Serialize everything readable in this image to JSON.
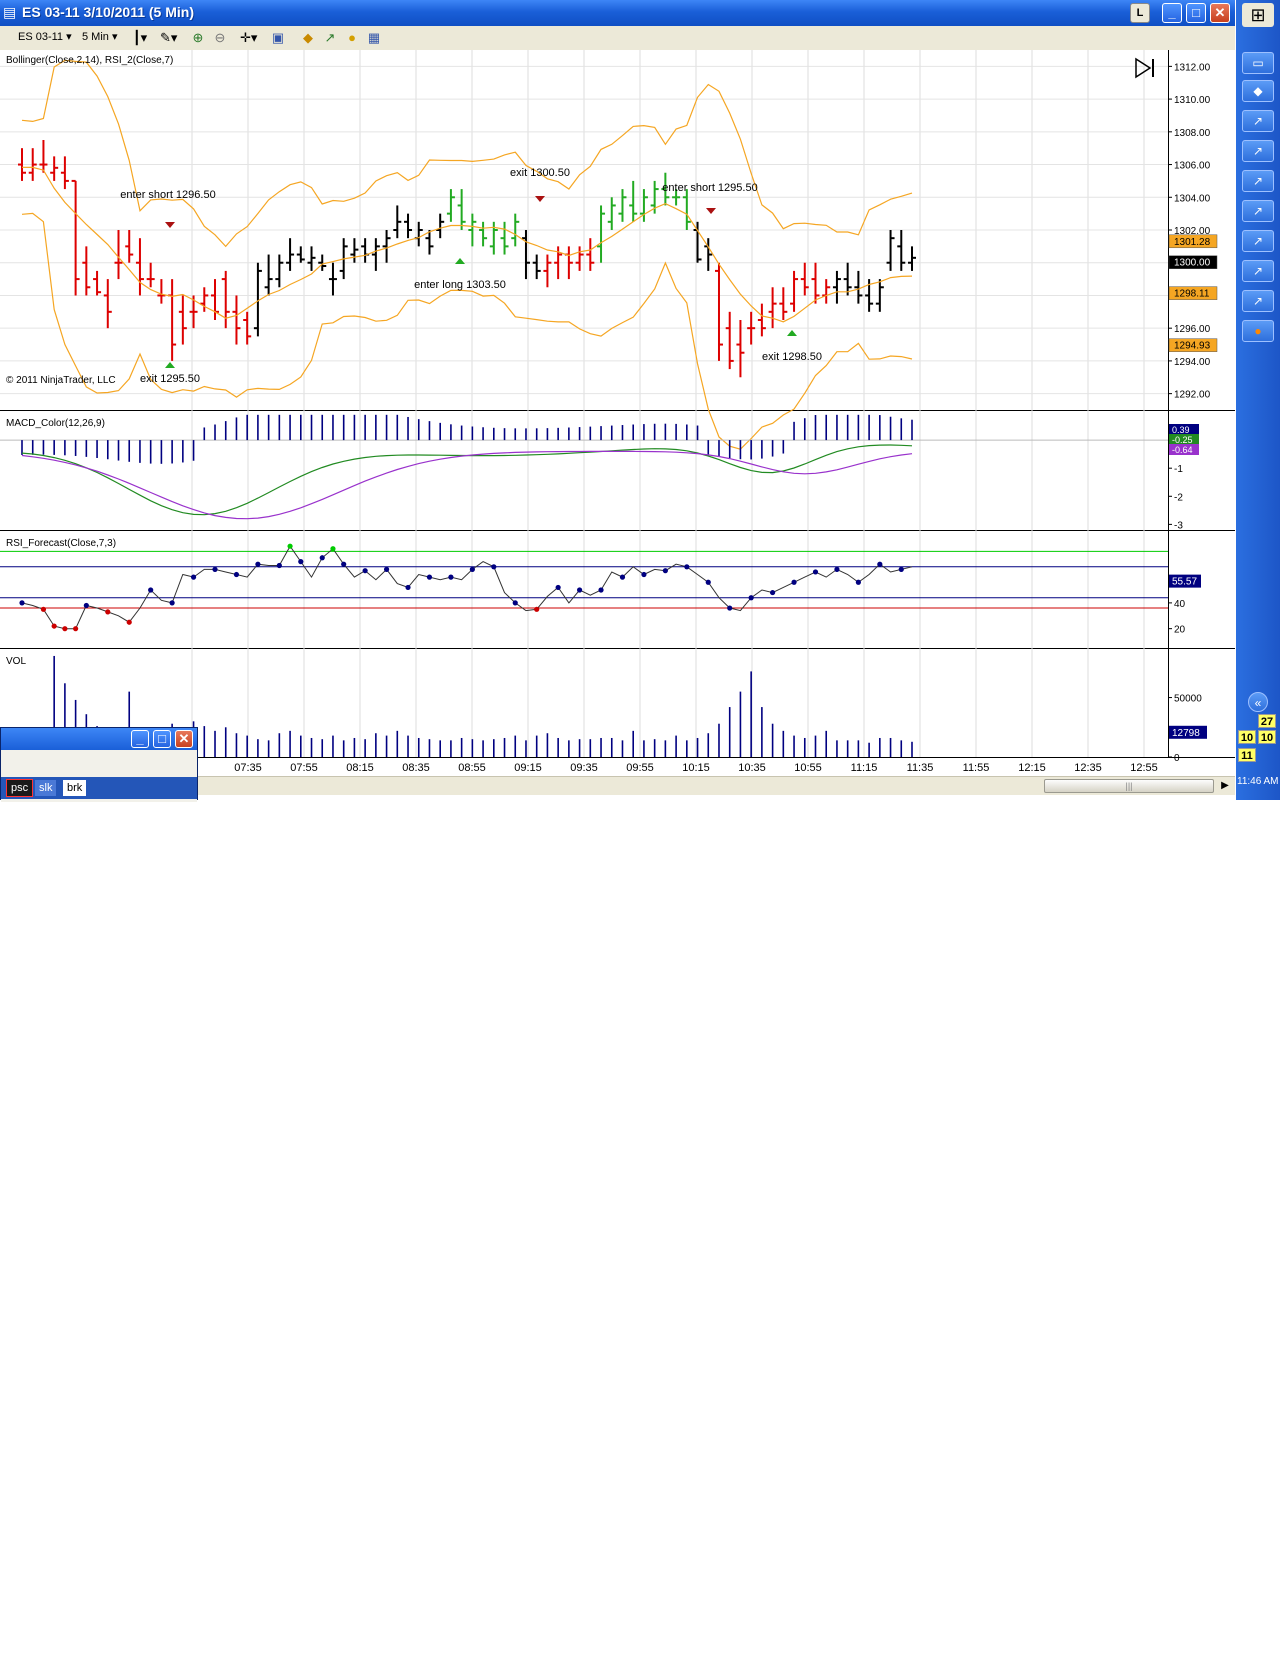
{
  "window": {
    "title": "ES 03-11  3/10/2011 (5 Min)",
    "btn_l": "L",
    "btn_min": "_",
    "btn_max": "□",
    "btn_close": "✕"
  },
  "toolbar": {
    "instrument": "ES 03-11",
    "interval": "5 Min",
    "icons": [
      "bar-type-icon",
      "pencil-icon",
      "zoom-in-icon",
      "zoom-out-icon",
      "crosshair-icon",
      "properties-icon",
      "strategy-icon",
      "indicators-icon",
      "dollar-icon",
      "data-box-icon"
    ]
  },
  "chart": {
    "price_panel_label": "Bollinger(Close,2,14), RSI_2(Close,7)",
    "macd_panel_label": "MACD_Color(12,26,9)",
    "rsi_panel_label": "RSI_Forecast(Close,7,3)",
    "vol_panel_label": "VOL",
    "copyright": "© 2011 NinjaTrader, LLC",
    "price_ticks": [
      "1312.00",
      "1310.00",
      "1308.00",
      "1306.00",
      "1304.00",
      "1302.00",
      "1300.00",
      "1298.00",
      "1296.00",
      "1294.00",
      "1292.00"
    ],
    "price_tick_values": [
      1312,
      1310,
      1308,
      1306,
      1304,
      1302,
      1300,
      1298,
      1296,
      1294,
      1292
    ],
    "macd_ticks": [
      "-1",
      "-2",
      "-3"
    ],
    "rsi_ticks": [
      "40",
      "20"
    ],
    "vol_ticks": [
      "50000",
      "0"
    ],
    "time_ticks": [
      "5",
      "07:35",
      "07:55",
      "08:15",
      "08:35",
      "08:55",
      "09:15",
      "09:35",
      "09:55",
      "10:15",
      "10:35",
      "10:55",
      "11:15",
      "11:35",
      "11:55",
      "12:15",
      "12:35",
      "12:55"
    ],
    "price_badges": [
      {
        "label": "1301.28",
        "value": 1301.28,
        "bg": "#f5a623",
        "fg": "#000000"
      },
      {
        "label": "1300.00",
        "value": 1300.0,
        "bg": "#000000",
        "fg": "#ffffff"
      },
      {
        "label": "1298.11",
        "value": 1298.11,
        "bg": "#f5a623",
        "fg": "#000000"
      },
      {
        "label": "1294.93",
        "value": 1294.93,
        "bg": "#f5a623",
        "fg": "#000000"
      }
    ],
    "macd_badges": [
      {
        "label": "0.39",
        "bg": "#000080",
        "fg": "#ffffff"
      },
      {
        "label": "-0.25",
        "bg": "#228b22",
        "fg": "#ffffff"
      },
      {
        "label": "-0.64",
        "bg": "#9932cc",
        "fg": "#ffffff"
      }
    ],
    "rsi_badge": {
      "label": "55.57",
      "bg": "#000080",
      "fg": "#ffffff"
    },
    "vol_badge": {
      "label": "12798",
      "bg": "#000080",
      "fg": "#ffffff"
    },
    "annotations": [
      {
        "text": "enter short 1296.50",
        "kind": "enter_short"
      },
      {
        "text": "exit 1295.50",
        "kind": "exit_long"
      },
      {
        "text": "exit 1300.50",
        "kind": "exit_short"
      },
      {
        "text": "enter long 1303.50",
        "kind": "enter_long"
      },
      {
        "text": "enter short 1295.50",
        "kind": "enter_short"
      },
      {
        "text": "exit 1298.50",
        "kind": "exit_long"
      }
    ],
    "colors": {
      "up": "#22aa22",
      "down": "#dd0000",
      "neutral": "#000000",
      "band": "#f5a623",
      "macd_fast": "#228b22",
      "macd_slow": "#9932cc",
      "hist": "#000080",
      "ob": "#00cc00",
      "os": "#cc0000"
    }
  },
  "mini_window": {
    "tabs": [
      {
        "label": "psc",
        "active": true
      },
      {
        "label": "slk",
        "active": false
      },
      {
        "label": "brk",
        "active": false
      }
    ]
  },
  "dock": {
    "numbers": [
      "27",
      "10",
      "10",
      "11"
    ],
    "clock": "11:46 AM"
  }
}
